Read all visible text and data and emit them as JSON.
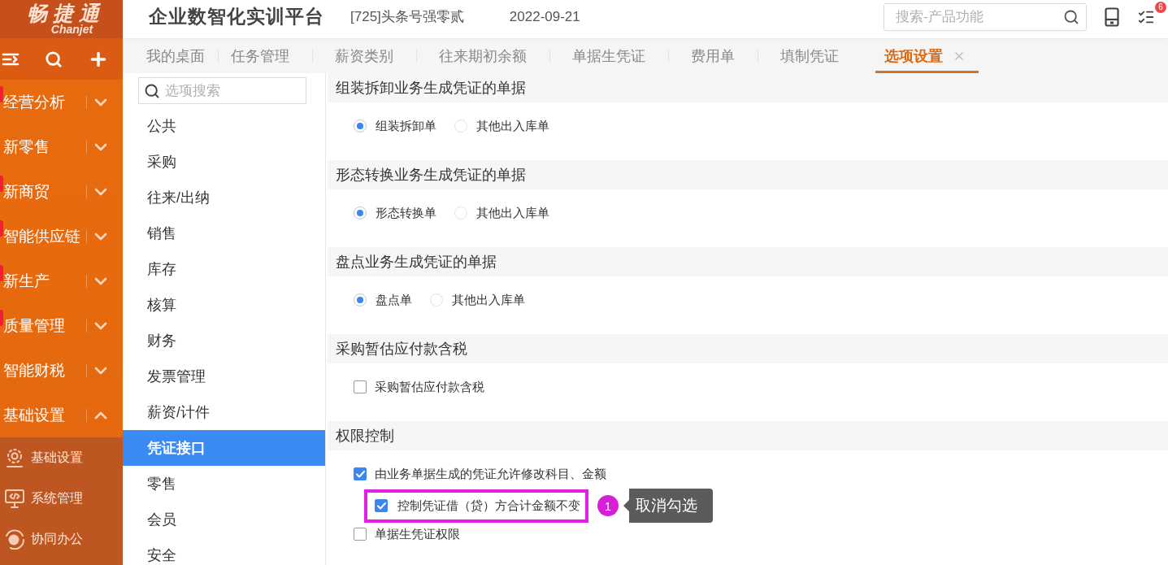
{
  "logo": {
    "name": "畅捷通",
    "latin": "Chanjet"
  },
  "sidebar": {
    "items": [
      {
        "label": "经营分析",
        "flagged": true,
        "expanded": false
      },
      {
        "label": "新零售",
        "flagged": false,
        "expanded": false
      },
      {
        "label": "新商贸",
        "flagged": true,
        "expanded": false
      },
      {
        "label": "智能供应链",
        "flagged": true,
        "expanded": false
      },
      {
        "label": "新生产",
        "flagged": true,
        "expanded": false
      },
      {
        "label": "质量管理",
        "flagged": true,
        "expanded": false
      },
      {
        "label": "智能财税",
        "flagged": false,
        "expanded": false
      },
      {
        "label": "基础设置",
        "flagged": false,
        "expanded": true,
        "children": [
          {
            "label": "基础设置"
          },
          {
            "label": "系统管理"
          },
          {
            "label": "协同办公"
          }
        ]
      }
    ]
  },
  "header": {
    "title": "企业数智化实训平台",
    "account": "[725]头条号强零贰",
    "date": "2022-09-21",
    "search": {
      "placeholder": "搜索-产品功能"
    },
    "notification_badge": "6"
  },
  "tabs": [
    {
      "label": "我的桌面",
      "selected": false,
      "closable": false
    },
    {
      "label": "任务管理",
      "selected": false,
      "closable": false
    },
    {
      "label": "薪资类别",
      "selected": false,
      "closable": false
    },
    {
      "label": "往来期初余额",
      "selected": false,
      "closable": false
    },
    {
      "label": "单据生凭证",
      "selected": false,
      "closable": false
    },
    {
      "label": "费用单",
      "selected": false,
      "closable": false
    },
    {
      "label": "填制凭证",
      "selected": false,
      "closable": false
    },
    {
      "label": "选项设置",
      "selected": true,
      "closable": true
    }
  ],
  "options_nav": {
    "search": {
      "placeholder": "选项搜索"
    },
    "items": [
      {
        "label": "公共",
        "selected": false
      },
      {
        "label": "采购",
        "selected": false
      },
      {
        "label": "往来/出纳",
        "selected": false
      },
      {
        "label": "销售",
        "selected": false
      },
      {
        "label": "库存",
        "selected": false
      },
      {
        "label": "核算",
        "selected": false
      },
      {
        "label": "财务",
        "selected": false
      },
      {
        "label": "发票管理",
        "selected": false
      },
      {
        "label": "薪资/计件",
        "selected": false
      },
      {
        "label": "凭证接口",
        "selected": true
      },
      {
        "label": "零售",
        "selected": false
      },
      {
        "label": "会员",
        "selected": false
      },
      {
        "label": "安全",
        "selected": false
      }
    ]
  },
  "sections": [
    {
      "title": "组装拆卸业务生成凭证的单据",
      "kind": "radio",
      "options": [
        {
          "label": "组装拆卸单",
          "selected": true
        },
        {
          "label": "其他出入库单",
          "selected": false
        }
      ]
    },
    {
      "title": "形态转换业务生成凭证的单据",
      "kind": "radio",
      "options": [
        {
          "label": "形态转换单",
          "selected": true
        },
        {
          "label": "其他出入库单",
          "selected": false
        }
      ]
    },
    {
      "title": "盘点业务生成凭证的单据",
      "kind": "radio",
      "options": [
        {
          "label": "盘点单",
          "selected": true
        },
        {
          "label": "其他出入库单",
          "selected": false
        }
      ]
    },
    {
      "title": "采购暂估应付款含税",
      "kind": "checkbox",
      "options": [
        {
          "label": "采购暂估应付款含税",
          "checked": false
        }
      ]
    },
    {
      "title": "权限控制",
      "kind": "checkbox",
      "options": [
        {
          "label": "由业务单据生成的凭证允许修改科目、金额",
          "checked": true,
          "children": [
            {
              "label": "控制凭证借（贷）方合计金额不变",
              "checked": true,
              "highlighted": true,
              "annotation": {
                "number": "1",
                "text": "取消勾选"
              }
            }
          ]
        },
        {
          "label": "单据生凭证权限",
          "checked": false
        }
      ]
    }
  ]
}
